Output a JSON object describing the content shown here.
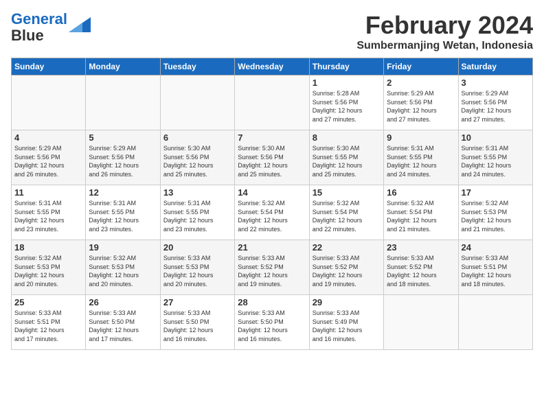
{
  "header": {
    "logo_line1": "General",
    "logo_line2": "Blue",
    "month": "February 2024",
    "location": "Sumbermanjing Wetan, Indonesia"
  },
  "days_of_week": [
    "Sunday",
    "Monday",
    "Tuesday",
    "Wednesday",
    "Thursday",
    "Friday",
    "Saturday"
  ],
  "weeks": [
    [
      {
        "day": "",
        "info": ""
      },
      {
        "day": "",
        "info": ""
      },
      {
        "day": "",
        "info": ""
      },
      {
        "day": "",
        "info": ""
      },
      {
        "day": "1",
        "info": "Sunrise: 5:28 AM\nSunset: 5:56 PM\nDaylight: 12 hours\nand 27 minutes."
      },
      {
        "day": "2",
        "info": "Sunrise: 5:29 AM\nSunset: 5:56 PM\nDaylight: 12 hours\nand 27 minutes."
      },
      {
        "day": "3",
        "info": "Sunrise: 5:29 AM\nSunset: 5:56 PM\nDaylight: 12 hours\nand 27 minutes."
      }
    ],
    [
      {
        "day": "4",
        "info": "Sunrise: 5:29 AM\nSunset: 5:56 PM\nDaylight: 12 hours\nand 26 minutes."
      },
      {
        "day": "5",
        "info": "Sunrise: 5:29 AM\nSunset: 5:56 PM\nDaylight: 12 hours\nand 26 minutes."
      },
      {
        "day": "6",
        "info": "Sunrise: 5:30 AM\nSunset: 5:56 PM\nDaylight: 12 hours\nand 25 minutes."
      },
      {
        "day": "7",
        "info": "Sunrise: 5:30 AM\nSunset: 5:56 PM\nDaylight: 12 hours\nand 25 minutes."
      },
      {
        "day": "8",
        "info": "Sunrise: 5:30 AM\nSunset: 5:55 PM\nDaylight: 12 hours\nand 25 minutes."
      },
      {
        "day": "9",
        "info": "Sunrise: 5:31 AM\nSunset: 5:55 PM\nDaylight: 12 hours\nand 24 minutes."
      },
      {
        "day": "10",
        "info": "Sunrise: 5:31 AM\nSunset: 5:55 PM\nDaylight: 12 hours\nand 24 minutes."
      }
    ],
    [
      {
        "day": "11",
        "info": "Sunrise: 5:31 AM\nSunset: 5:55 PM\nDaylight: 12 hours\nand 23 minutes."
      },
      {
        "day": "12",
        "info": "Sunrise: 5:31 AM\nSunset: 5:55 PM\nDaylight: 12 hours\nand 23 minutes."
      },
      {
        "day": "13",
        "info": "Sunrise: 5:31 AM\nSunset: 5:55 PM\nDaylight: 12 hours\nand 23 minutes."
      },
      {
        "day": "14",
        "info": "Sunrise: 5:32 AM\nSunset: 5:54 PM\nDaylight: 12 hours\nand 22 minutes."
      },
      {
        "day": "15",
        "info": "Sunrise: 5:32 AM\nSunset: 5:54 PM\nDaylight: 12 hours\nand 22 minutes."
      },
      {
        "day": "16",
        "info": "Sunrise: 5:32 AM\nSunset: 5:54 PM\nDaylight: 12 hours\nand 21 minutes."
      },
      {
        "day": "17",
        "info": "Sunrise: 5:32 AM\nSunset: 5:53 PM\nDaylight: 12 hours\nand 21 minutes."
      }
    ],
    [
      {
        "day": "18",
        "info": "Sunrise: 5:32 AM\nSunset: 5:53 PM\nDaylight: 12 hours\nand 20 minutes."
      },
      {
        "day": "19",
        "info": "Sunrise: 5:32 AM\nSunset: 5:53 PM\nDaylight: 12 hours\nand 20 minutes."
      },
      {
        "day": "20",
        "info": "Sunrise: 5:33 AM\nSunset: 5:53 PM\nDaylight: 12 hours\nand 20 minutes."
      },
      {
        "day": "21",
        "info": "Sunrise: 5:33 AM\nSunset: 5:52 PM\nDaylight: 12 hours\nand 19 minutes."
      },
      {
        "day": "22",
        "info": "Sunrise: 5:33 AM\nSunset: 5:52 PM\nDaylight: 12 hours\nand 19 minutes."
      },
      {
        "day": "23",
        "info": "Sunrise: 5:33 AM\nSunset: 5:52 PM\nDaylight: 12 hours\nand 18 minutes."
      },
      {
        "day": "24",
        "info": "Sunrise: 5:33 AM\nSunset: 5:51 PM\nDaylight: 12 hours\nand 18 minutes."
      }
    ],
    [
      {
        "day": "25",
        "info": "Sunrise: 5:33 AM\nSunset: 5:51 PM\nDaylight: 12 hours\nand 17 minutes."
      },
      {
        "day": "26",
        "info": "Sunrise: 5:33 AM\nSunset: 5:50 PM\nDaylight: 12 hours\nand 17 minutes."
      },
      {
        "day": "27",
        "info": "Sunrise: 5:33 AM\nSunset: 5:50 PM\nDaylight: 12 hours\nand 16 minutes."
      },
      {
        "day": "28",
        "info": "Sunrise: 5:33 AM\nSunset: 5:50 PM\nDaylight: 12 hours\nand 16 minutes."
      },
      {
        "day": "29",
        "info": "Sunrise: 5:33 AM\nSunset: 5:49 PM\nDaylight: 12 hours\nand 16 minutes."
      },
      {
        "day": "",
        "info": ""
      },
      {
        "day": "",
        "info": ""
      }
    ]
  ]
}
